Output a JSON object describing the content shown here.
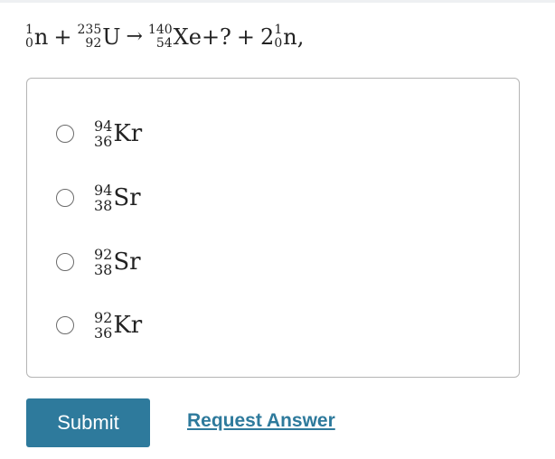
{
  "question": {
    "reactants": [
      {
        "mass": "1",
        "atomic": "0",
        "symbol": "n"
      },
      {
        "mass": "235",
        "atomic": "92",
        "symbol": "U"
      }
    ],
    "plus": "+",
    "arrow": "→",
    "product_xe": {
      "mass": "140",
      "atomic": "54",
      "symbol": "Xe"
    },
    "unknown": "+?",
    "plus2": "+",
    "coefficient": "2",
    "product_n": {
      "mass": "1",
      "atomic": "0",
      "symbol": "n"
    },
    "trailing": ","
  },
  "options": [
    {
      "mass": "94",
      "atomic": "36",
      "symbol": "Kr"
    },
    {
      "mass": "94",
      "atomic": "38",
      "symbol": "Sr"
    },
    {
      "mass": "92",
      "atomic": "38",
      "symbol": "Sr"
    },
    {
      "mass": "92",
      "atomic": "36",
      "symbol": "Kr"
    }
  ],
  "buttons": {
    "submit": "Submit",
    "request_answer": "Request Answer"
  },
  "colors": {
    "accent": "#2e7a9c",
    "border": "#b5b5b5"
  }
}
